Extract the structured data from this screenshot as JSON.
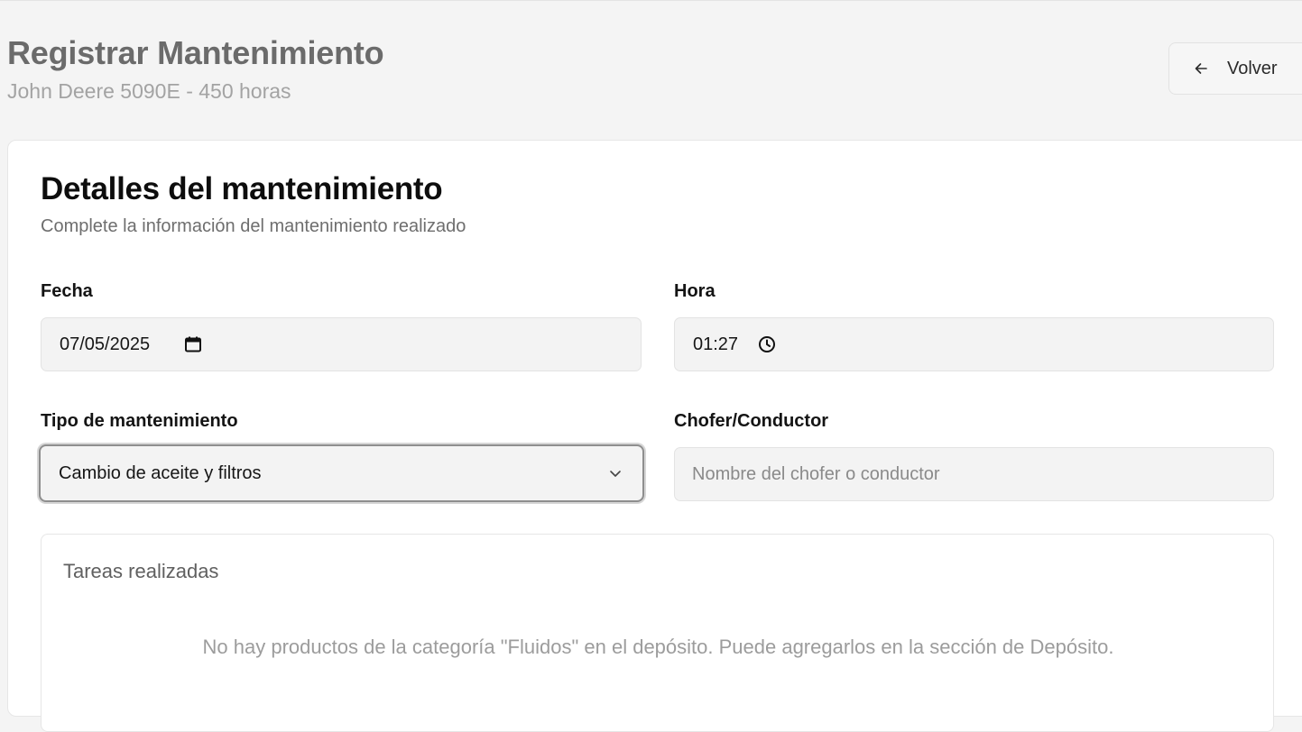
{
  "header": {
    "title": "Registrar Mantenimiento",
    "subtitle": "John Deere 5090E - 450 horas",
    "back_button": {
      "label": "Volver",
      "icon": "arrow-left-icon"
    }
  },
  "card": {
    "title": "Detalles del mantenimiento",
    "subtitle": "Complete la información del mantenimiento realizado",
    "fields": {
      "fecha": {
        "label": "Fecha",
        "value": "07/05/2025",
        "icon": "calendar-icon"
      },
      "hora": {
        "label": "Hora",
        "value": "01:27",
        "icon": "clock-icon"
      },
      "tipo": {
        "label": "Tipo de mantenimiento",
        "value": "Cambio de aceite y filtros",
        "icon": "chevron-down-icon"
      },
      "chofer": {
        "label": "Chofer/Conductor",
        "value": "",
        "placeholder": "Nombre del chofer o conductor"
      }
    },
    "tasks": {
      "title": "Tareas realizadas",
      "empty_message": "No hay productos de la categoría \"Fluidos\" en el depósito. Puede agregarlos en la sección de Depósito."
    }
  }
}
